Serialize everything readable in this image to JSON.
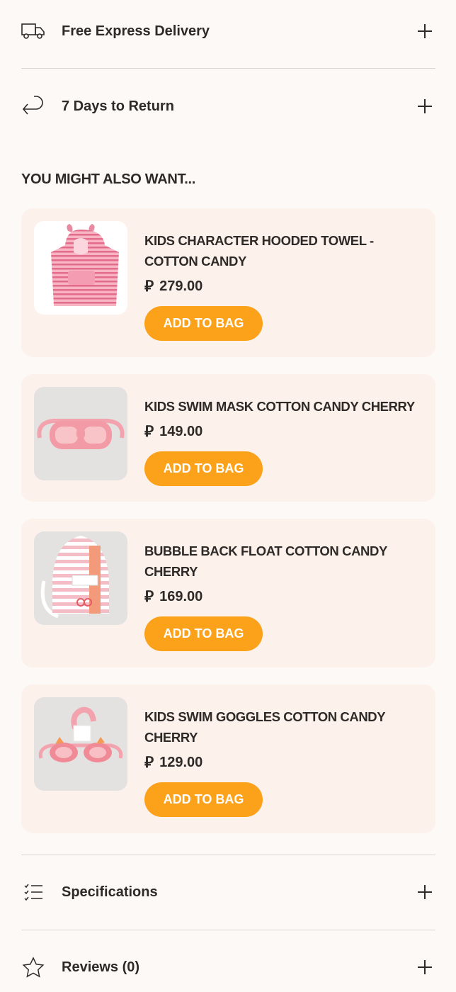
{
  "accordion": {
    "delivery": {
      "label": "Free Express Delivery",
      "icon": "truck-icon"
    },
    "returns": {
      "label": "7 Days to Return",
      "icon": "return-arrow-icon"
    },
    "specifications": {
      "label": "Specifications",
      "icon": "checklist-icon"
    },
    "reviews": {
      "label": "Reviews (0)",
      "icon": "star-icon"
    }
  },
  "recommendations": {
    "title": "YOU MIGHT ALSO WANT...",
    "currency_symbol": "⃃",
    "items": [
      {
        "name": "KIDS CHARACTER HOODED TOWEL - COTTON CANDY",
        "price": "279.00",
        "button": "ADD TO BAG"
      },
      {
        "name": "KIDS SWIM MASK COTTON CANDY CHERRY",
        "price": "149.00",
        "button": "ADD TO BAG"
      },
      {
        "name": "BUBBLE BACK FLOAT COTTON CANDY CHERRY",
        "price": "169.00",
        "button": "ADD TO BAG"
      },
      {
        "name": "KIDS SWIM GOGGLES COTTON CANDY CHERRY",
        "price": "129.00",
        "button": "ADD TO BAG"
      }
    ]
  },
  "colors": {
    "background": "#fdf9f6",
    "card": "#fdf1ec",
    "accent": "#fca11a",
    "text": "#2d2a27"
  }
}
